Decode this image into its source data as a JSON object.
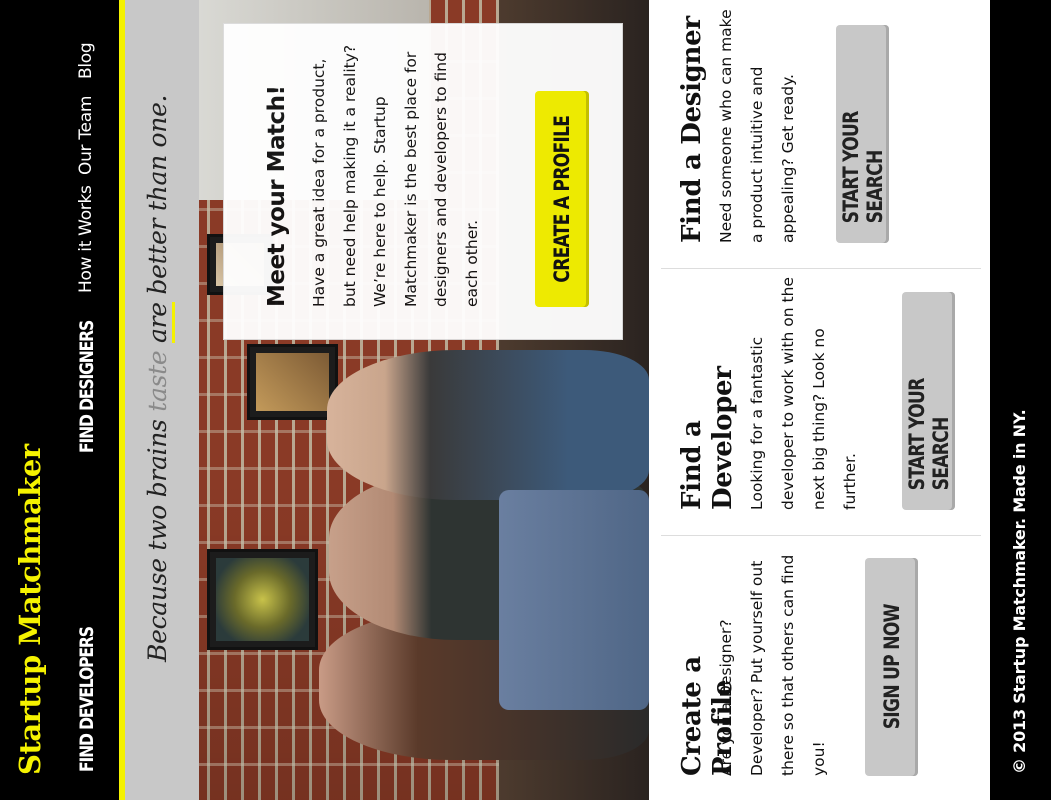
{
  "header": {
    "brand": "Startup Matchmaker",
    "nav": [
      "FIND DEVELOPERS",
      "FIND DESIGNERS",
      "How it Works",
      "Our Team",
      "Blog"
    ]
  },
  "tagline": {
    "part1": "Because two brains ",
    "taste": "taste",
    "part2": " ",
    "are": "are",
    "part3": " better than one."
  },
  "hero_card": {
    "title": "Meet your Match!",
    "body": "Have a great idea for a product, but need help making it a reality? We’re here to help. Startup Matchmaker is the best place for designers and developers to find each other.",
    "button": "CREATE A PROFILE"
  },
  "features": [
    {
      "title": "Create a Profile",
      "body": "Are you a Designer? Developer? Put yourself out there so that others can find you!",
      "button": "SIGN UP NOW"
    },
    {
      "title": "Find a Developer",
      "body": "Looking for a fantastic developer to work with on the next big thing? Look no further.",
      "button": "START YOUR SEARCH"
    },
    {
      "title": "Find a Designer",
      "body": "Need someone who can make a product intuitive and appealing? Get ready.",
      "button": "START YOUR SEARCH"
    }
  ],
  "footer": {
    "text": "© 2013 Startup Matchmaker. Made in NY."
  },
  "colors": {
    "accent": "#f5f200",
    "black": "#000000",
    "gray": "#c8c8c8"
  }
}
